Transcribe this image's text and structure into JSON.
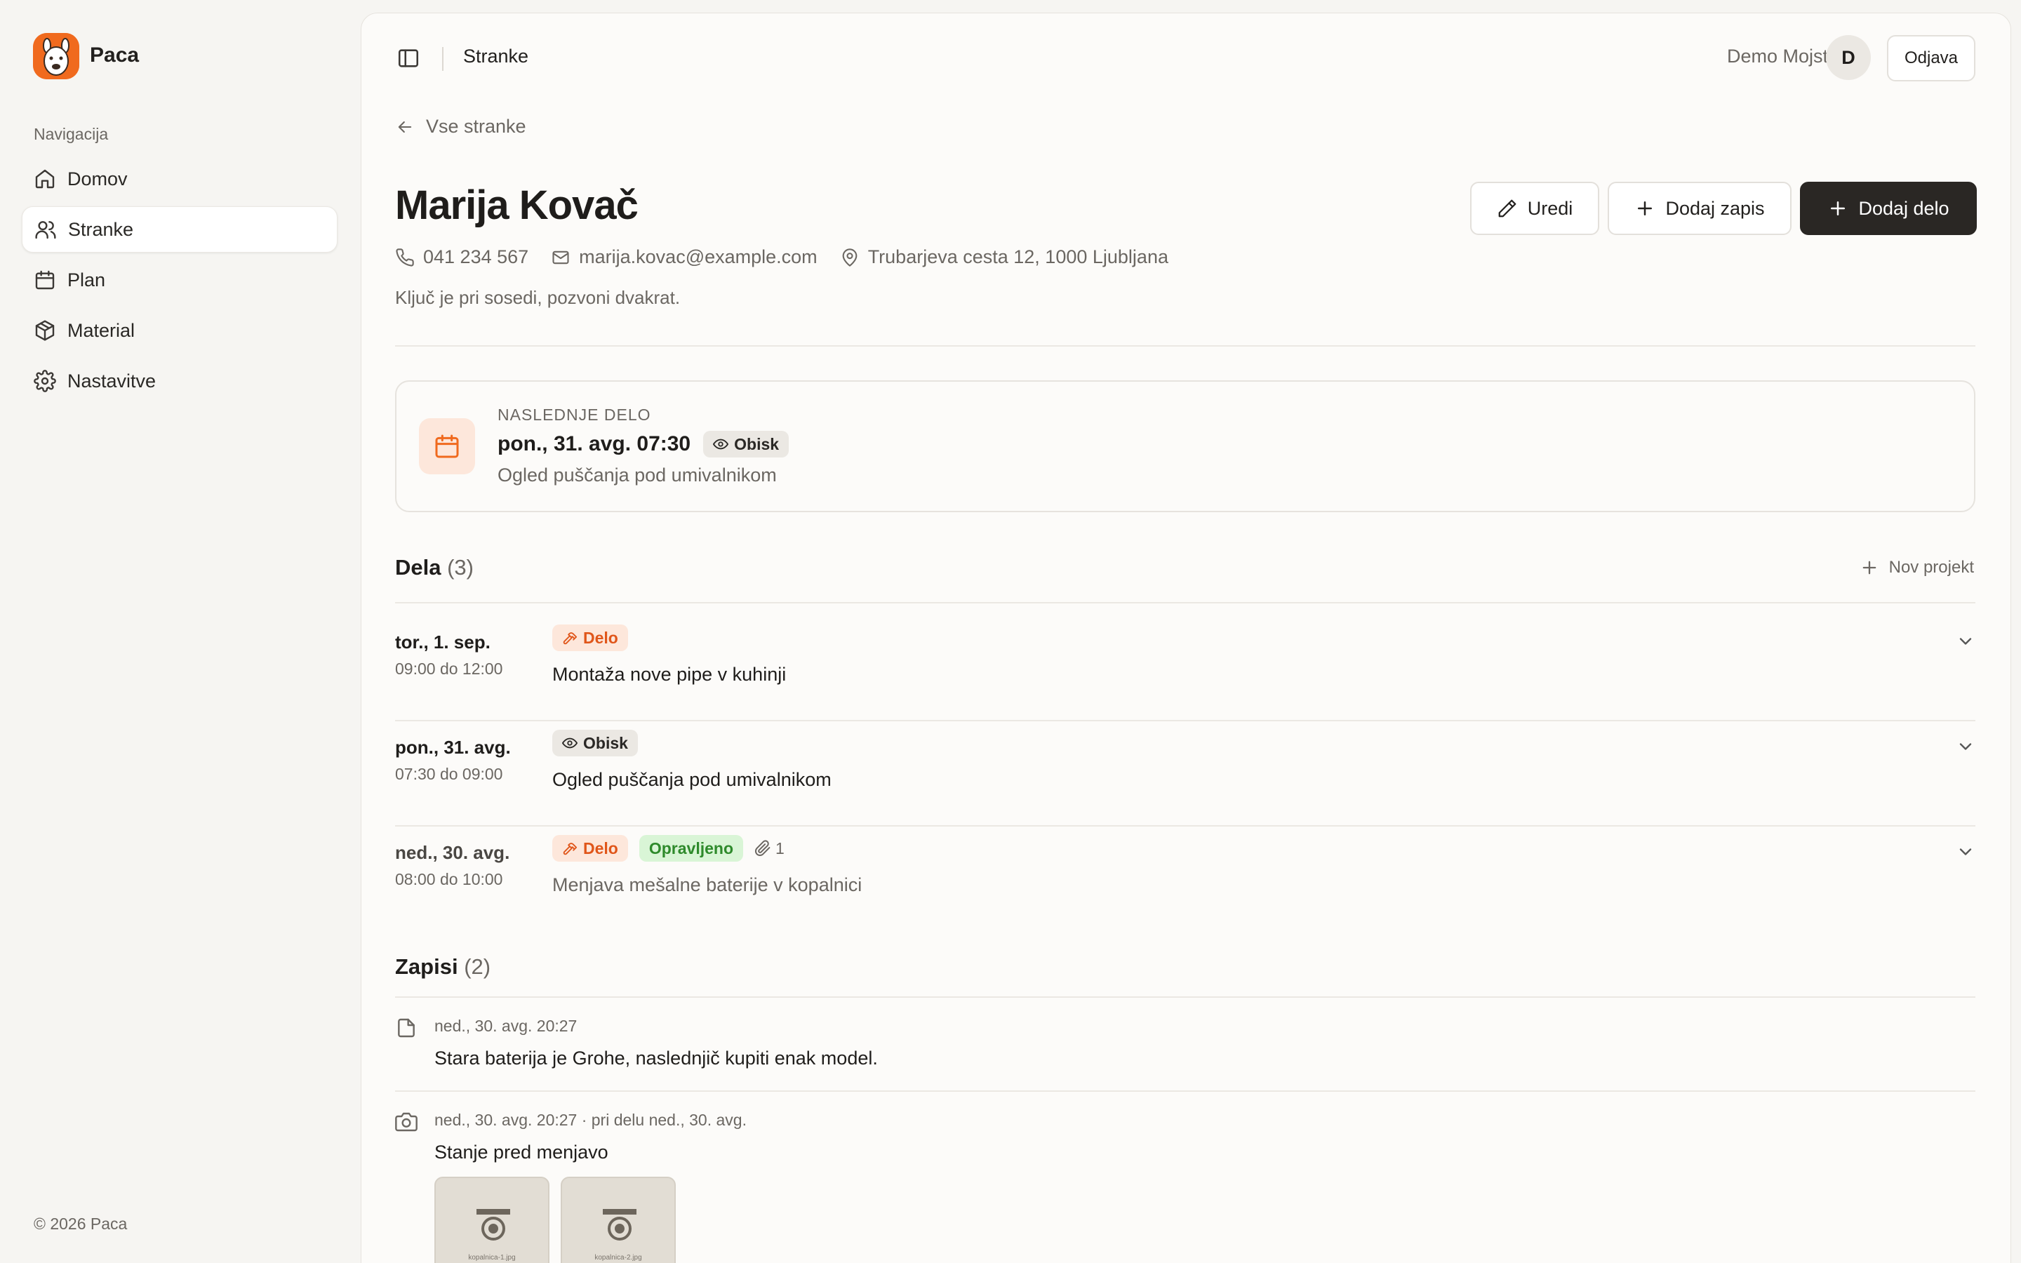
{
  "app": {
    "name": "Paca",
    "footer": "© 2026 Paca"
  },
  "sidebar": {
    "heading": "Navigacija",
    "items": [
      {
        "label": "Domov",
        "icon": "home-icon"
      },
      {
        "label": "Stranke",
        "icon": "users-icon",
        "active": true
      },
      {
        "label": "Plan",
        "icon": "calendar-icon"
      },
      {
        "label": "Material",
        "icon": "box-icon"
      },
      {
        "label": "Nastavitve",
        "icon": "gear-icon"
      }
    ]
  },
  "header": {
    "title": "Stranke",
    "user_name": "Demo Mojster",
    "avatar_initial": "D",
    "logout_label": "Odjava"
  },
  "back_link": "Vse stranke",
  "client": {
    "name": "Marija Kovač",
    "phone": "041 234 567",
    "email": "marija.kovac@example.com",
    "address": "Trubarjeva cesta 12, 1000 Ljubljana",
    "note": "Ključ je pri sosedi, pozvoni dvakrat."
  },
  "actions": {
    "edit": "Uredi",
    "add_note": "Dodaj zapis",
    "add_job": "Dodaj delo"
  },
  "next_job": {
    "label": "NASLEDNJE DELO",
    "datetime": "pon., 31. avg. 07:30",
    "badge": "Obisk",
    "description": "Ogled puščanja pod umivalnikom"
  },
  "jobs": {
    "title": "Dela",
    "count": "(3)",
    "new_project": "Nov projekt",
    "items": [
      {
        "date": "tor., 1. sep.",
        "time": "09:00 do 12:00",
        "type": "Delo",
        "title": "Montaža nove pipe v kuhinji"
      },
      {
        "date": "pon., 31. avg.",
        "time": "07:30 do 09:00",
        "type": "Obisk",
        "title": "Ogled puščanja pod umivalnikom"
      },
      {
        "date": "ned., 30. avg.",
        "time": "08:00 do 10:00",
        "type": "Delo",
        "status": "Opravljeno",
        "attachments": "1",
        "title": "Menjava mešalne baterije v kopalnici"
      }
    ]
  },
  "notes": {
    "title": "Zapisi",
    "count": "(2)",
    "items": [
      {
        "meta": "ned., 30. avg. 20:27",
        "text": "Stara baterija je Grohe, naslednjič kupiti enak model.",
        "icon": "file-icon"
      },
      {
        "meta": "ned., 30. avg. 20:27 · pri delu ned., 30. avg.",
        "text": "Stanje pred menjavo",
        "icon": "camera-icon",
        "images": [
          "kopalnica-1.jpg",
          "kopalnica-2.jpg"
        ]
      }
    ]
  },
  "colors": {
    "accent": "#f06a1e",
    "dark_button": "#2a2724",
    "success": "#2e8a2b"
  }
}
